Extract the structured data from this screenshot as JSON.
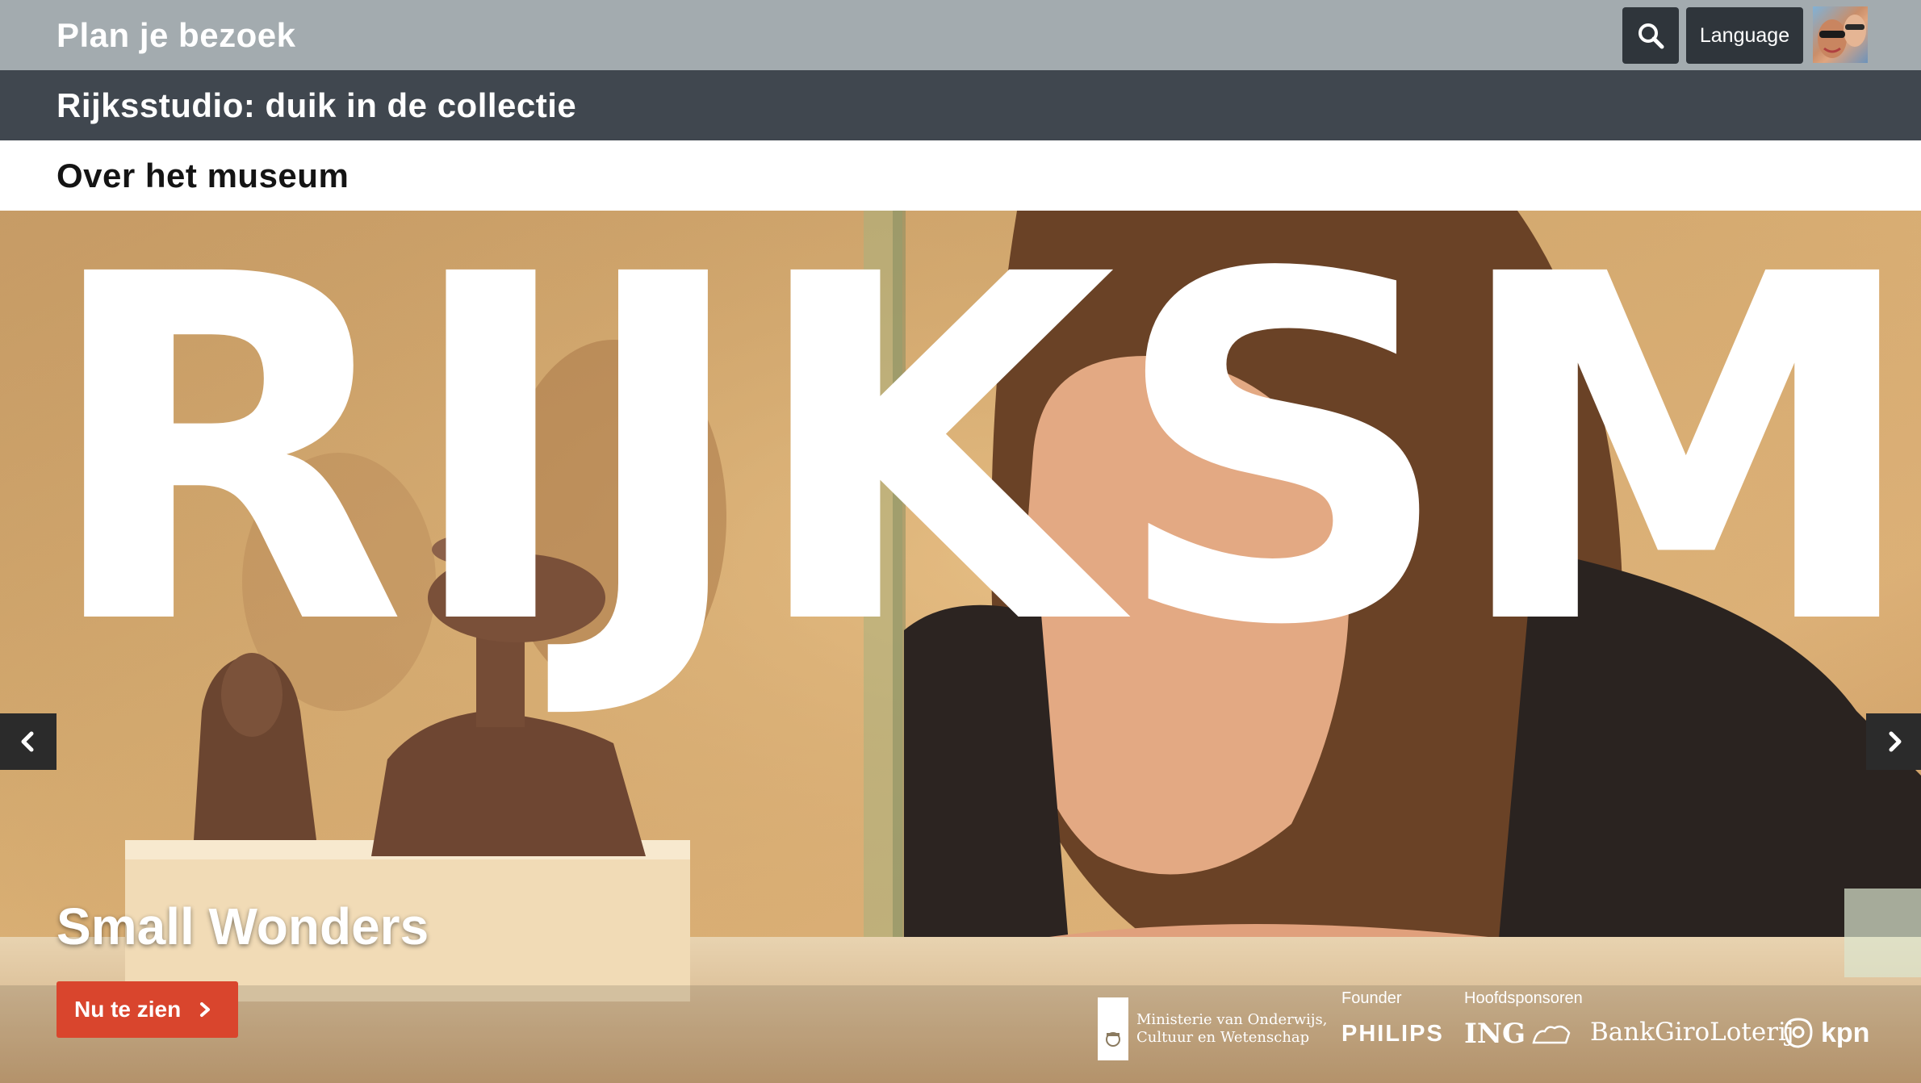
{
  "nav": {
    "visit_label": "Plan je bezoek",
    "studio_label": "Rijksstudio: duik in de collectie",
    "about_label": "Over het museum",
    "language_label": "Language",
    "search_icon": "search-icon"
  },
  "hero": {
    "wordmark": "RIJKSMU",
    "exhibit_title": "Small Wonders",
    "cta_label": "Nu te zien",
    "prev_icon": "chevron-left-icon",
    "next_icon": "chevron-right-icon"
  },
  "sponsors": {
    "ministry_line1": "Ministerie van Onderwijs,",
    "ministry_line2": "Cultuur en Wetenschap",
    "founder_caption": "Founder",
    "main_caption": "Hoofdsponsoren",
    "philips": "PHILIPS",
    "ing": "ING",
    "bankgiro": "BankGiroLoterij",
    "kpn": "kpn"
  },
  "colors": {
    "top_bar": "#a3abaf",
    "studio_bar": "#40474f",
    "cta": "#d9452d"
  }
}
